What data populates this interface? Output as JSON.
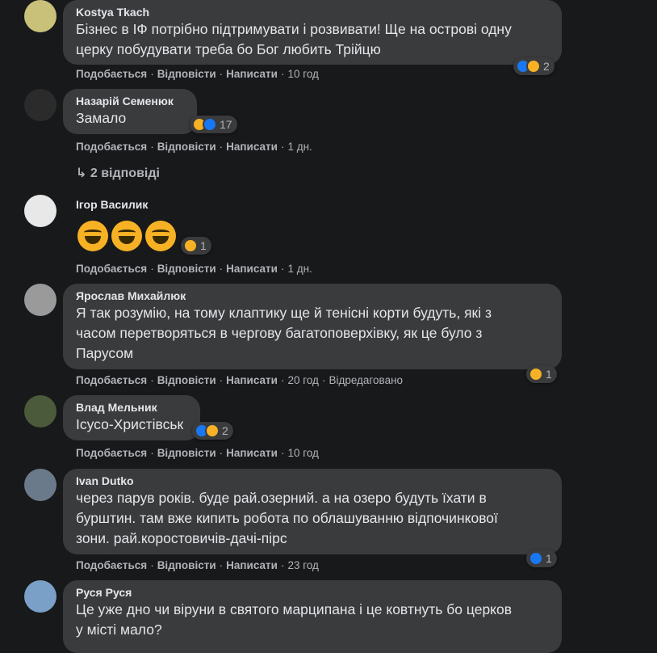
{
  "actions": {
    "like": "Подобається",
    "reply": "Відповісти",
    "write": "Написати",
    "edited": "Відредаговано"
  },
  "comments": [
    {
      "author": "Kostya Tkach",
      "lines": [
        "Бізнес в ІФ потрібно підтримувати і розвивати! Ще на острові одну",
        "церку побудувати треба бо Бог любить Трійцю"
      ],
      "time": "10 год",
      "reactions": "2"
    },
    {
      "author": "Назарій Семенюк",
      "lines": [
        "Замало"
      ],
      "time": "1 дн.",
      "reactions": "17"
    },
    {
      "author": "Ігор Василик",
      "lines": [],
      "emoji": "😆😆😆",
      "time": "1 дн.",
      "reactions": "1"
    },
    {
      "author": "Ярослав Михайлюк",
      "lines": [
        "Я так розумію, на тому клаптику ще й тенісні корти будуть, які з",
        "часом перетворяться в чергову багатоповерхівку, як це було з",
        "Парусом"
      ],
      "time": "20 год",
      "reactions": "1"
    },
    {
      "author": "Влад Мельник",
      "lines": [
        "Ісусо-Христівськ"
      ],
      "time": "10 год",
      "reactions": "2"
    },
    {
      "author": "Ivan Dutko",
      "lines": [
        "через парув років. буде рай.озерний. а на озеро будуть їхати в",
        "бурштин. там вже кипить робота по облашуванню відпочинкової",
        "зони. рай.коростовичів-дачі-пірс"
      ],
      "time": "23 год",
      "reactions": "1"
    },
    {
      "author": "Руся Руся",
      "lines": [
        "Це уже дно чи віруни в святого марципана і це ковтнуть бо церков",
        "у місті мало?"
      ]
    }
  ],
  "replies_link": "2 відповіді",
  "colors": {
    "background": "#18191a",
    "bubble": "#3a3b3c",
    "text": "#e4e6eb",
    "meta": "#b0b3b8",
    "like": "#1877f2",
    "haha": "#f7b125"
  }
}
